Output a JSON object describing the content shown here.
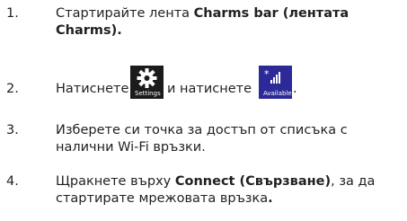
{
  "steps": [
    {
      "num": "1.",
      "pre": "Стартирайте лента ",
      "bold": "Charms bar (лентата Charms).",
      "post": ""
    },
    {
      "num": "2.",
      "text_a": "Натиснете",
      "text_b": "и натиснете",
      "text_c": ".",
      "settings_tile_label": "Settings",
      "settings_icon": "gear-icon",
      "network_tile_label": "Available",
      "network_icon": "wifi-signal-icon"
    },
    {
      "num": "3.",
      "text": "Изберете си точка за достъп от списъка с налични Wi-Fi връзки."
    },
    {
      "num": "4.",
      "pre": "Щракнете върху ",
      "bold": "Connect (Свързване)",
      "mid": ", за да стартирате мрежовата връзка",
      "bold_end": "."
    }
  ],
  "colors": {
    "text": "#231f20",
    "settings_tile": "#1b1b1b",
    "network_tile": "#2c2a97"
  }
}
